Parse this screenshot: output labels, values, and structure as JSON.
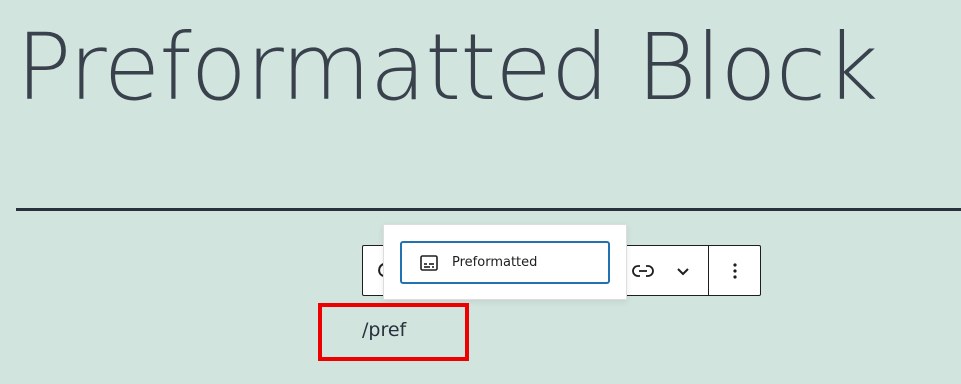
{
  "editor": {
    "post_title": "Preformatted Block",
    "typed_text": "/pref"
  },
  "slash_inserter": {
    "options": [
      {
        "label": "Preformatted",
        "icon": "preformatted-icon"
      }
    ]
  },
  "block_toolbar": {
    "icons": [
      "link-icon",
      "chevron-down-icon",
      "more-vertical-icon"
    ]
  },
  "colors": {
    "background": "#d1e4dd",
    "text": "#28303d",
    "focus_border": "#2271b1",
    "highlight": "#ee0000"
  }
}
